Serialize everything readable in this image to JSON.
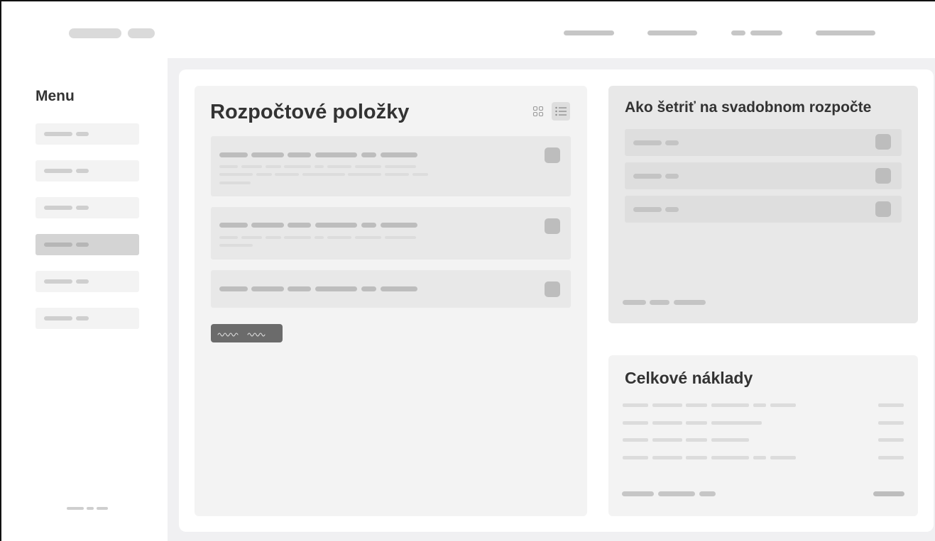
{
  "sidebar": {
    "title": "Menu",
    "items": [
      {
        "active": false
      },
      {
        "active": false
      },
      {
        "active": false
      },
      {
        "active": true
      },
      {
        "active": false
      },
      {
        "active": false
      }
    ]
  },
  "budget_items": {
    "title": "Rozpočtové položky",
    "view_modes": [
      "grid-icon",
      "list-icon"
    ],
    "active_view": "list-icon",
    "action_button_label": "~~~~ ~~~"
  },
  "tips": {
    "title": "Ako šetriť na svadobnom rozpočte"
  },
  "total_costs": {
    "title": "Celkové náklady"
  },
  "colors": {
    "page_bg": "#f0f0f2",
    "panel_bg": "#f3f3f3",
    "card_bg": "#e8e8e8",
    "button_dark": "#6b6b6b",
    "placeholder": "#d2d2d2"
  }
}
